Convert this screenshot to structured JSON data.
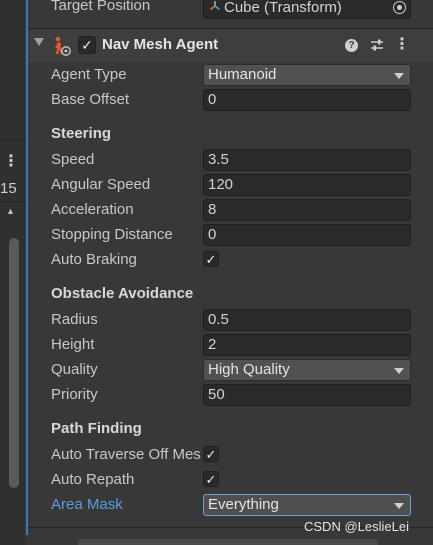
{
  "gutter": {
    "menu_glyph": "⋮",
    "number": "15",
    "up_glyph": "▲"
  },
  "top_field": {
    "label": "Target Position",
    "value": "Cube (Transform)",
    "icon": "transform-icon",
    "picker_icon": "object-picker-icon"
  },
  "component": {
    "title": "Nav Mesh Agent",
    "enabled": true,
    "check_glyph": "✓",
    "help_glyph": "?",
    "menu_glyph": "⋮",
    "icons": [
      "nav-mesh-agent-icon",
      "help-icon",
      "preset-icon",
      "kebab-menu-icon"
    ]
  },
  "props": {
    "agent_type": {
      "label": "Agent Type",
      "value": "Humanoid"
    },
    "base_offset": {
      "label": "Base Offset",
      "value": "0"
    },
    "steering_header": "Steering",
    "speed": {
      "label": "Speed",
      "value": "3.5"
    },
    "angular_speed": {
      "label": "Angular Speed",
      "value": "120"
    },
    "acceleration": {
      "label": "Acceleration",
      "value": "8"
    },
    "stopping_distance": {
      "label": "Stopping Distance",
      "value": "0"
    },
    "auto_braking": {
      "label": "Auto Braking",
      "checked": true,
      "glyph": "✓"
    },
    "obstacle_header": "Obstacle Avoidance",
    "radius": {
      "label": "Radius",
      "value": "0.5"
    },
    "height": {
      "label": "Height",
      "value": "2"
    },
    "quality": {
      "label": "Quality",
      "value": "High Quality"
    },
    "priority": {
      "label": "Priority",
      "value": "50"
    },
    "pathfinding_header": "Path Finding",
    "auto_traverse": {
      "label": "Auto Traverse Off Mesh Link",
      "checked": true,
      "glyph": "✓"
    },
    "auto_repath": {
      "label": "Auto Repath",
      "checked": true,
      "glyph": "✓"
    },
    "area_mask": {
      "label": "Area Mask",
      "value": "Everything"
    }
  },
  "watermark": "CSDN @LeslieLei",
  "colors": {
    "background": "#383838",
    "selection_bar": "#3a79bb",
    "area_mask_label": "#5b9be0",
    "field_bg": "#2a2a2a",
    "dropdown_bg": "#515151"
  }
}
